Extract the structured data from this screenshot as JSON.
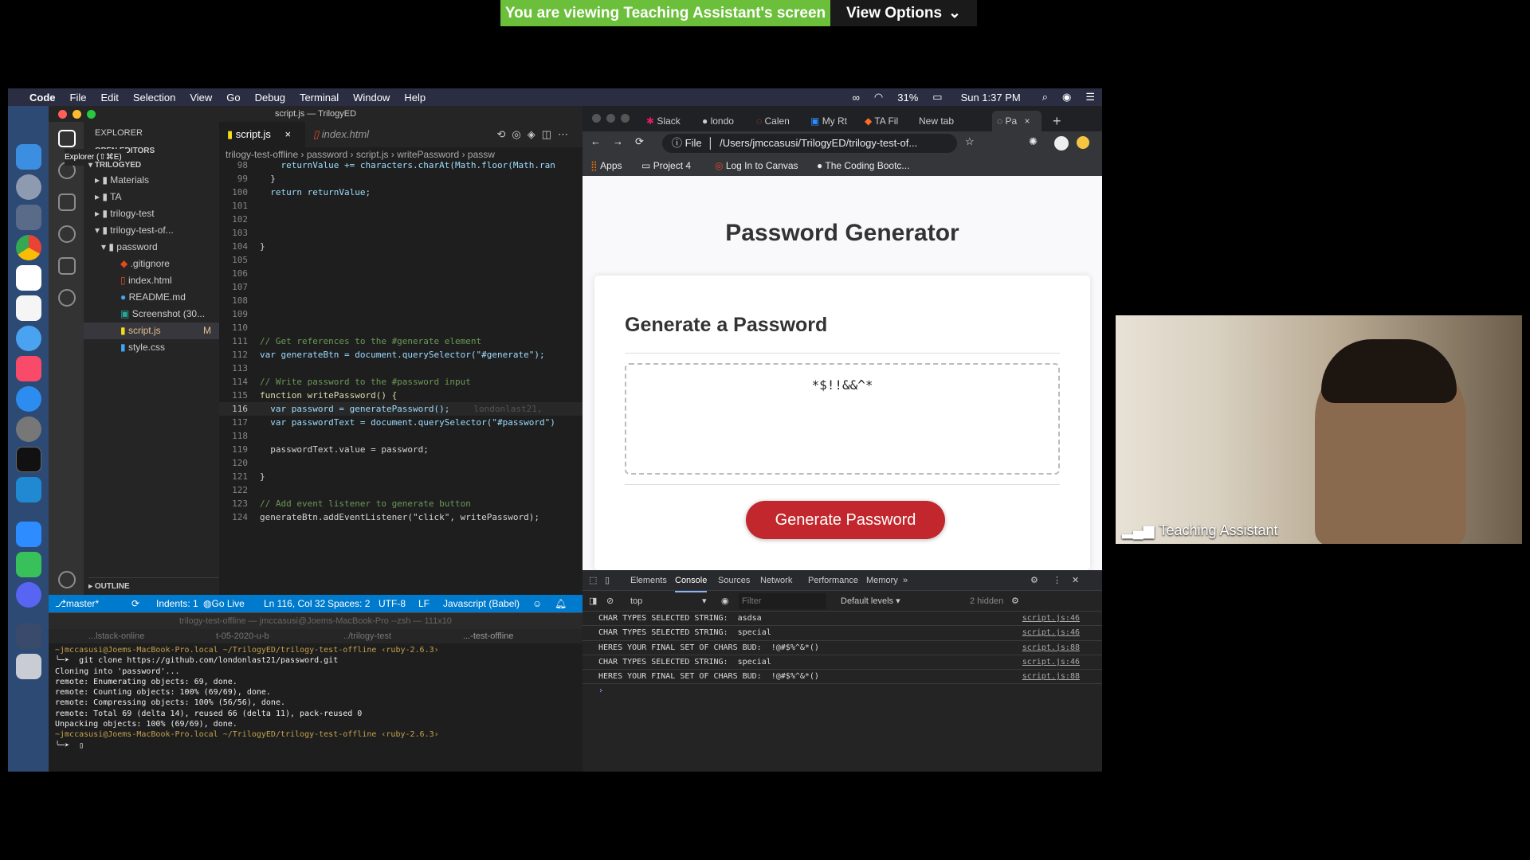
{
  "zoom": {
    "banner": "You are viewing Teaching Assistant's screen",
    "view_options": "View Options",
    "participant_name": "Teaching Assistant"
  },
  "macos": {
    "app": "Code",
    "menus": [
      "File",
      "Edit",
      "Selection",
      "View",
      "Go",
      "Debug",
      "Terminal",
      "Window",
      "Help"
    ],
    "battery": "31%",
    "clock": "Sun 1:37 PM"
  },
  "vscode": {
    "window_title": "script.js — TrilogyED",
    "explorer_label": "EXPLORER",
    "open_editors": "OPEN EDITORS",
    "tooltip": "Explorer (⇧⌘E)",
    "workspace": "TRILOGYED",
    "tree": [
      {
        "label": "Materials",
        "kind": "folder"
      },
      {
        "label": "TA",
        "kind": "folder"
      },
      {
        "label": "trilogy-test",
        "kind": "folder"
      },
      {
        "label": "trilogy-test-of...",
        "kind": "folder-open"
      },
      {
        "label": "password",
        "kind": "folder-open"
      },
      {
        "label": ".gitignore",
        "kind": "git"
      },
      {
        "label": "index.html",
        "kind": "html"
      },
      {
        "label": "README.md",
        "kind": "info"
      },
      {
        "label": "Screenshot (30...",
        "kind": "image"
      },
      {
        "label": "script.js",
        "kind": "js",
        "badge": "M"
      },
      {
        "label": "style.css",
        "kind": "css"
      }
    ],
    "outline": "OUTLINE",
    "tabs": [
      "script.js",
      "index.html"
    ],
    "breadcrumb": [
      "trilogy-test-offline",
      "password",
      "script.js",
      "writePassword",
      "passw"
    ],
    "code_lines": [
      {
        "n": "98",
        "t": "    returnValue += characters.charAt(Math.floor(Math.ran"
      },
      {
        "n": "99",
        "t": "  }"
      },
      {
        "n": "100",
        "t": "  return returnValue;"
      },
      {
        "n": "101",
        "t": ""
      },
      {
        "n": "102",
        "t": ""
      },
      {
        "n": "103",
        "t": ""
      },
      {
        "n": "104",
        "t": "}"
      },
      {
        "n": "105",
        "t": ""
      },
      {
        "n": "106",
        "t": ""
      },
      {
        "n": "107",
        "t": ""
      },
      {
        "n": "108",
        "t": ""
      },
      {
        "n": "109",
        "t": ""
      },
      {
        "n": "110",
        "t": ""
      },
      {
        "n": "111",
        "t": "// Get references to the #generate element"
      },
      {
        "n": "112",
        "t": "var generateBtn = document.querySelector(\"#generate\");"
      },
      {
        "n": "113",
        "t": ""
      },
      {
        "n": "114",
        "t": "// Write password to the #password input"
      },
      {
        "n": "115",
        "t": "function writePassword() {"
      },
      {
        "n": "116",
        "t": "  var password = generatePassword();"
      },
      {
        "n": "117",
        "t": "  var passwordText = document.querySelector(\"#password\")"
      },
      {
        "n": "118",
        "t": ""
      },
      {
        "n": "119",
        "t": "  passwordText.value = password;"
      },
      {
        "n": "120",
        "t": ""
      },
      {
        "n": "121",
        "t": "}"
      },
      {
        "n": "122",
        "t": ""
      },
      {
        "n": "123",
        "t": "// Add event listener to generate button"
      },
      {
        "n": "124",
        "t": "generateBtn.addEventListener(\"click\", writePassword);"
      }
    ],
    "blame": "londonlast21,",
    "status": {
      "branch": "master*",
      "indents": "Indents: 1",
      "golive": "Go Live",
      "position": "Ln 116, Col 32",
      "spaces": "Spaces: 2",
      "encoding": "UTF-8",
      "eol": "LF",
      "language": "Javascript (Babel)"
    }
  },
  "terminal": {
    "title": "trilogy-test-offline — jmccasusi@Joems-MacBook-Pro --zsh — 111x10",
    "tabs": [
      "...lstack-online",
      "t-05-2020-u-b",
      "../trilogy-test",
      "...-test-offline"
    ],
    "lines": [
      "~jmccasusi@Joems-MacBook-Pro.local ~/TrilogyED/trilogy-test-offline ‹ruby-2.6.3›",
      "╰─➤  git clone https://github.com/londonlast21/password.git",
      "Cloning into 'password'...",
      "remote: Enumerating objects: 69, done.",
      "remote: Counting objects: 100% (69/69), done.",
      "remote: Compressing objects: 100% (56/56), done.",
      "remote: Total 69 (delta 14), reused 66 (delta 11), pack-reused 0",
      "Unpacking objects: 100% (69/69), done.",
      "~jmccasusi@Joems-MacBook-Pro.local ~/TrilogyED/trilogy-test-offline ‹ruby-2.6.3›",
      "╰─➤  ▯"
    ]
  },
  "chrome": {
    "tabs": [
      "Slack",
      "londo",
      "Calen",
      "My Rt",
      "TA Fil",
      "New tab",
      "Pa"
    ],
    "file_label": "File",
    "url": "/Users/jmccasusi/TrilogyED/trilogy-test-of...",
    "bookmarks": [
      "Apps",
      "Project 4",
      "Log In to Canvas",
      "The Coding Bootc..."
    ],
    "page": {
      "title": "Password Generator",
      "card_title": "Generate a Password",
      "password": "*$!!&&^*",
      "button": "Generate Password"
    },
    "devtools": {
      "tabs": [
        "Elements",
        "Console",
        "Sources",
        "Network",
        "Performance",
        "Memory"
      ],
      "context": "top",
      "filter_placeholder": "Filter",
      "levels": "Default levels ▾",
      "hidden": "2 hidden",
      "logs": [
        {
          "msg": "CHAR TYPES SELECTED STRING:  asdsa",
          "src": "script.js:46"
        },
        {
          "msg": "CHAR TYPES SELECTED STRING:  special",
          "src": "script.js:46"
        },
        {
          "msg": "HERES YOUR FINAL SET OF CHARS BUD:  !@#$%^&*()",
          "src": "script.js:88"
        },
        {
          "msg": "CHAR TYPES SELECTED STRING:  special",
          "src": "script.js:46"
        },
        {
          "msg": "HERES YOUR FINAL SET OF CHARS BUD:  !@#$%^&*()",
          "src": "script.js:88"
        }
      ]
    }
  }
}
